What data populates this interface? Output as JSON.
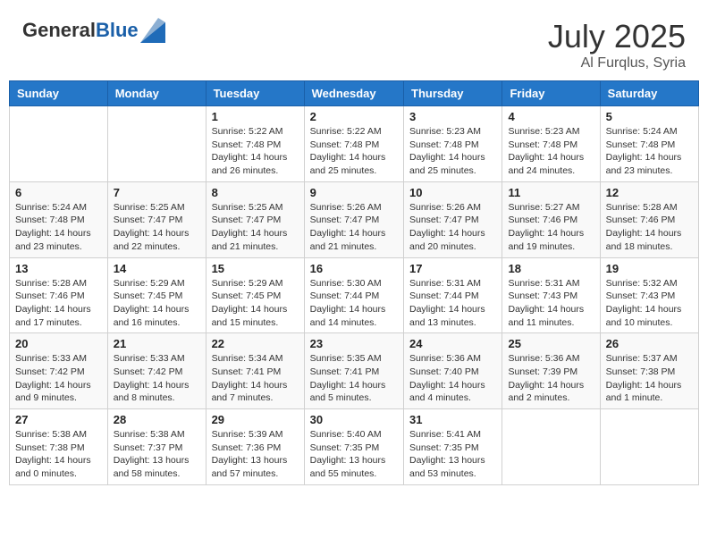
{
  "header": {
    "logo_general": "General",
    "logo_blue": "Blue",
    "month_year": "July 2025",
    "location": "Al Furqlus, Syria"
  },
  "days_of_week": [
    "Sunday",
    "Monday",
    "Tuesday",
    "Wednesday",
    "Thursday",
    "Friday",
    "Saturday"
  ],
  "weeks": [
    [
      {
        "day": "",
        "detail": ""
      },
      {
        "day": "",
        "detail": ""
      },
      {
        "day": "1",
        "detail": "Sunrise: 5:22 AM\nSunset: 7:48 PM\nDaylight: 14 hours and 26 minutes."
      },
      {
        "day": "2",
        "detail": "Sunrise: 5:22 AM\nSunset: 7:48 PM\nDaylight: 14 hours and 25 minutes."
      },
      {
        "day": "3",
        "detail": "Sunrise: 5:23 AM\nSunset: 7:48 PM\nDaylight: 14 hours and 25 minutes."
      },
      {
        "day": "4",
        "detail": "Sunrise: 5:23 AM\nSunset: 7:48 PM\nDaylight: 14 hours and 24 minutes."
      },
      {
        "day": "5",
        "detail": "Sunrise: 5:24 AM\nSunset: 7:48 PM\nDaylight: 14 hours and 23 minutes."
      }
    ],
    [
      {
        "day": "6",
        "detail": "Sunrise: 5:24 AM\nSunset: 7:48 PM\nDaylight: 14 hours and 23 minutes."
      },
      {
        "day": "7",
        "detail": "Sunrise: 5:25 AM\nSunset: 7:47 PM\nDaylight: 14 hours and 22 minutes."
      },
      {
        "day": "8",
        "detail": "Sunrise: 5:25 AM\nSunset: 7:47 PM\nDaylight: 14 hours and 21 minutes."
      },
      {
        "day": "9",
        "detail": "Sunrise: 5:26 AM\nSunset: 7:47 PM\nDaylight: 14 hours and 21 minutes."
      },
      {
        "day": "10",
        "detail": "Sunrise: 5:26 AM\nSunset: 7:47 PM\nDaylight: 14 hours and 20 minutes."
      },
      {
        "day": "11",
        "detail": "Sunrise: 5:27 AM\nSunset: 7:46 PM\nDaylight: 14 hours and 19 minutes."
      },
      {
        "day": "12",
        "detail": "Sunrise: 5:28 AM\nSunset: 7:46 PM\nDaylight: 14 hours and 18 minutes."
      }
    ],
    [
      {
        "day": "13",
        "detail": "Sunrise: 5:28 AM\nSunset: 7:46 PM\nDaylight: 14 hours and 17 minutes."
      },
      {
        "day": "14",
        "detail": "Sunrise: 5:29 AM\nSunset: 7:45 PM\nDaylight: 14 hours and 16 minutes."
      },
      {
        "day": "15",
        "detail": "Sunrise: 5:29 AM\nSunset: 7:45 PM\nDaylight: 14 hours and 15 minutes."
      },
      {
        "day": "16",
        "detail": "Sunrise: 5:30 AM\nSunset: 7:44 PM\nDaylight: 14 hours and 14 minutes."
      },
      {
        "day": "17",
        "detail": "Sunrise: 5:31 AM\nSunset: 7:44 PM\nDaylight: 14 hours and 13 minutes."
      },
      {
        "day": "18",
        "detail": "Sunrise: 5:31 AM\nSunset: 7:43 PM\nDaylight: 14 hours and 11 minutes."
      },
      {
        "day": "19",
        "detail": "Sunrise: 5:32 AM\nSunset: 7:43 PM\nDaylight: 14 hours and 10 minutes."
      }
    ],
    [
      {
        "day": "20",
        "detail": "Sunrise: 5:33 AM\nSunset: 7:42 PM\nDaylight: 14 hours and 9 minutes."
      },
      {
        "day": "21",
        "detail": "Sunrise: 5:33 AM\nSunset: 7:42 PM\nDaylight: 14 hours and 8 minutes."
      },
      {
        "day": "22",
        "detail": "Sunrise: 5:34 AM\nSunset: 7:41 PM\nDaylight: 14 hours and 7 minutes."
      },
      {
        "day": "23",
        "detail": "Sunrise: 5:35 AM\nSunset: 7:41 PM\nDaylight: 14 hours and 5 minutes."
      },
      {
        "day": "24",
        "detail": "Sunrise: 5:36 AM\nSunset: 7:40 PM\nDaylight: 14 hours and 4 minutes."
      },
      {
        "day": "25",
        "detail": "Sunrise: 5:36 AM\nSunset: 7:39 PM\nDaylight: 14 hours and 2 minutes."
      },
      {
        "day": "26",
        "detail": "Sunrise: 5:37 AM\nSunset: 7:38 PM\nDaylight: 14 hours and 1 minute."
      }
    ],
    [
      {
        "day": "27",
        "detail": "Sunrise: 5:38 AM\nSunset: 7:38 PM\nDaylight: 14 hours and 0 minutes."
      },
      {
        "day": "28",
        "detail": "Sunrise: 5:38 AM\nSunset: 7:37 PM\nDaylight: 13 hours and 58 minutes."
      },
      {
        "day": "29",
        "detail": "Sunrise: 5:39 AM\nSunset: 7:36 PM\nDaylight: 13 hours and 57 minutes."
      },
      {
        "day": "30",
        "detail": "Sunrise: 5:40 AM\nSunset: 7:35 PM\nDaylight: 13 hours and 55 minutes."
      },
      {
        "day": "31",
        "detail": "Sunrise: 5:41 AM\nSunset: 7:35 PM\nDaylight: 13 hours and 53 minutes."
      },
      {
        "day": "",
        "detail": ""
      },
      {
        "day": "",
        "detail": ""
      }
    ]
  ]
}
